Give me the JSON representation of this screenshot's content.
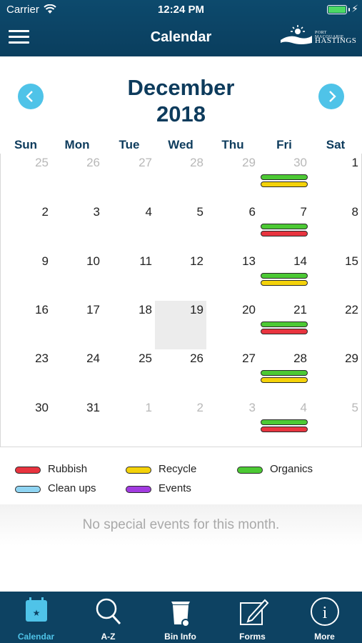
{
  "status_bar": {
    "carrier": "Carrier",
    "time": "12:24 PM"
  },
  "nav": {
    "title": "Calendar",
    "logo_line1": "PORT MACQUARIE",
    "logo_line2": "HASTINGS"
  },
  "calendar": {
    "month": "December",
    "year": "2018",
    "weekdays": [
      "Sun",
      "Mon",
      "Tue",
      "Wed",
      "Thu",
      "Fri",
      "Sat"
    ],
    "weeks": [
      [
        {
          "d": "25",
          "dim": true
        },
        {
          "d": "26",
          "dim": true
        },
        {
          "d": "27",
          "dim": true
        },
        {
          "d": "28",
          "dim": true
        },
        {
          "d": "29",
          "dim": true
        },
        {
          "d": "30",
          "dim": true,
          "bins": [
            "organics",
            "recycle"
          ]
        },
        {
          "d": "1"
        }
      ],
      [
        {
          "d": "2"
        },
        {
          "d": "3"
        },
        {
          "d": "4"
        },
        {
          "d": "5"
        },
        {
          "d": "6"
        },
        {
          "d": "7",
          "bins": [
            "organics",
            "rubbish"
          ]
        },
        {
          "d": "8"
        }
      ],
      [
        {
          "d": "9"
        },
        {
          "d": "10"
        },
        {
          "d": "11"
        },
        {
          "d": "12"
        },
        {
          "d": "13"
        },
        {
          "d": "14",
          "bins": [
            "organics",
            "recycle"
          ]
        },
        {
          "d": "15"
        }
      ],
      [
        {
          "d": "16"
        },
        {
          "d": "17"
        },
        {
          "d": "18"
        },
        {
          "d": "19",
          "today": true
        },
        {
          "d": "20"
        },
        {
          "d": "21",
          "bins": [
            "organics",
            "rubbish"
          ]
        },
        {
          "d": "22"
        }
      ],
      [
        {
          "d": "23"
        },
        {
          "d": "24"
        },
        {
          "d": "25"
        },
        {
          "d": "26"
        },
        {
          "d": "27"
        },
        {
          "d": "28",
          "bins": [
            "organics",
            "recycle"
          ]
        },
        {
          "d": "29"
        }
      ],
      [
        {
          "d": "30"
        },
        {
          "d": "31"
        },
        {
          "d": "1",
          "dim": true
        },
        {
          "d": "2",
          "dim": true
        },
        {
          "d": "3",
          "dim": true
        },
        {
          "d": "4",
          "dim": true,
          "bins": [
            "organics",
            "rubbish"
          ]
        },
        {
          "d": "5",
          "dim": true
        }
      ]
    ]
  },
  "legend": [
    {
      "key": "rubbish",
      "label": "Rubbish",
      "color": "#e8343f"
    },
    {
      "key": "recycle",
      "label": "Recycle",
      "color": "#f4d20a"
    },
    {
      "key": "organics",
      "label": "Organics",
      "color": "#4cc934"
    },
    {
      "key": "cleanups",
      "label": "Clean ups",
      "color": "#8fd4f2"
    },
    {
      "key": "events",
      "label": "Events",
      "color": "#a23be0"
    }
  ],
  "events_message": "No special events for this month.",
  "tabs": [
    {
      "label": "Calendar",
      "icon": "calendar-icon",
      "active": true
    },
    {
      "label": "A-Z",
      "icon": "search-icon"
    },
    {
      "label": "Bin Info",
      "icon": "bin-icon"
    },
    {
      "label": "Forms",
      "icon": "forms-icon"
    },
    {
      "label": "More",
      "icon": "info-icon"
    }
  ],
  "colors": {
    "header_bg": "#0d4a6d",
    "accent": "#4fc3e8",
    "title": "#0d3b5c",
    "tab_bg": "#0d4262"
  }
}
